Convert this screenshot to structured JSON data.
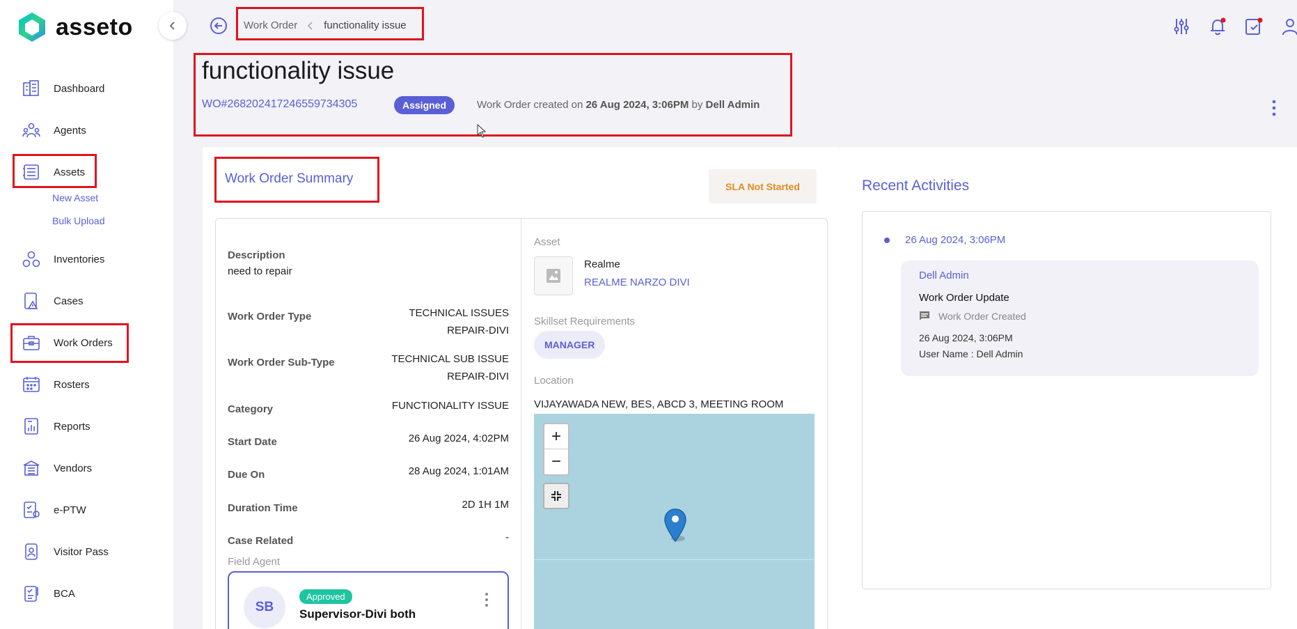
{
  "app": {
    "name": "asseto"
  },
  "sidebar": {
    "items": [
      {
        "label": "Dashboard",
        "icon": "dashboard-icon"
      },
      {
        "label": "Agents",
        "icon": "agents-icon"
      },
      {
        "label": "Assets",
        "icon": "assets-icon"
      },
      {
        "label": "Inventories",
        "icon": "inventories-icon"
      },
      {
        "label": "Cases",
        "icon": "cases-icon"
      },
      {
        "label": "Work Orders",
        "icon": "work-orders-icon"
      },
      {
        "label": "Rosters",
        "icon": "rosters-icon"
      },
      {
        "label": "Reports",
        "icon": "reports-icon"
      },
      {
        "label": "Vendors",
        "icon": "vendors-icon"
      },
      {
        "label": "e-PTW",
        "icon": "eptw-icon"
      },
      {
        "label": "Visitor Pass",
        "icon": "visitor-pass-icon"
      },
      {
        "label": "BCA",
        "icon": "bca-icon"
      }
    ],
    "asset_subitems": [
      "New Asset",
      "Bulk Upload"
    ]
  },
  "breadcrumb": {
    "parent": "Work Order",
    "current": "functionality issue"
  },
  "work_order": {
    "title": "functionality issue",
    "id": "WO#26820241724655973430​5",
    "status": "Assigned",
    "created_prefix": "Work Order created on",
    "created_date": "26 Aug 2024, 3:06PM",
    "created_by_prefix": "by",
    "created_by": "Dell Admin"
  },
  "summary": {
    "title": "Work Order Summary",
    "sla": "SLA Not Started",
    "description_label": "Description",
    "description": "need to repair",
    "fields": [
      {
        "label": "Work Order Type",
        "value1": "TECHNICAL ISSUES",
        "value2": "REPAIR-DIVI"
      },
      {
        "label": "Work Order Sub-Type",
        "value1": "TECHNICAL SUB ISSUE",
        "value2": "REPAIR-DIVI"
      },
      {
        "label": "Category",
        "value1": "FUNCTIONALITY ISSUE"
      },
      {
        "label": "Start Date",
        "value1": "26 Aug 2024, 4:02PM"
      },
      {
        "label": "Due On",
        "value1": "28 Aug 2024, 1:01AM"
      },
      {
        "label": "Duration Time",
        "value1": "2D 1H 1M"
      },
      {
        "label": "Case Related",
        "value1": "-"
      }
    ],
    "field_agent_label": "Field Agent",
    "agent": {
      "initials": "SB",
      "status": "Approved",
      "name": "Supervisor-Divi both"
    },
    "asset_label": "Asset",
    "asset_name": "Realme",
    "asset_model": "REALME NARZO DIVI",
    "skillset_label": "Skillset Requirements",
    "skill": "MANAGER",
    "location_label": "Location",
    "location": "VIJAYAWADA NEW, BES, ABCD 3, MEETING ROOM",
    "map": {
      "zoom_in": "+",
      "zoom_out": "−"
    }
  },
  "activities": {
    "title": "Recent Activities",
    "entries": [
      {
        "time": "26 Aug 2024, 3:06PM",
        "user": "Dell Admin",
        "heading": "Work Order Update",
        "sub": "Work Order Created",
        "date": "26 Aug 2024, 3:06PM",
        "username_line": "User Name : Dell Admin"
      }
    ]
  },
  "colors": {
    "accent": "#5a5fd6",
    "highlight": "#e0141e",
    "sla": "#e38b1f",
    "approved": "#1fc4a1"
  }
}
